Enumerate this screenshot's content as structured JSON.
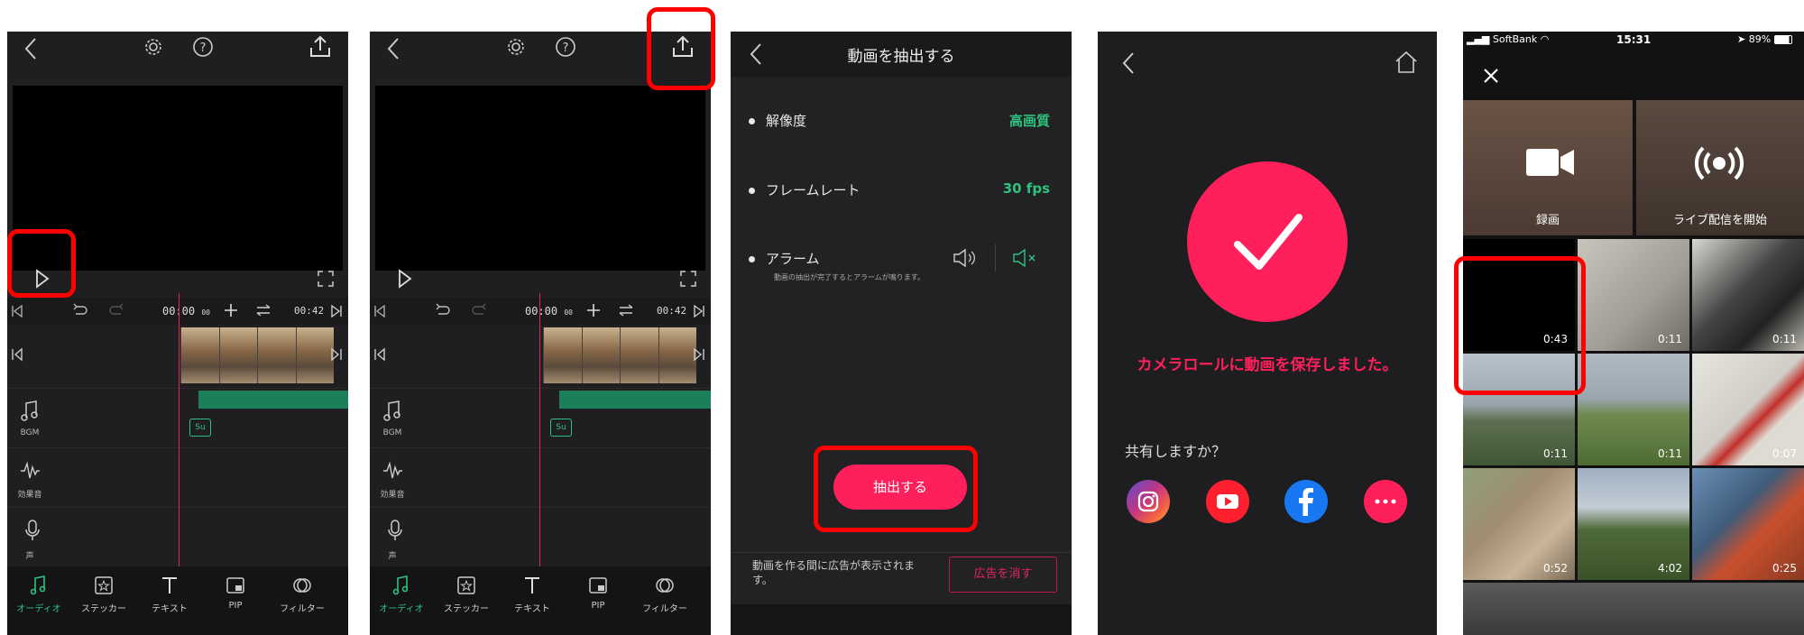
{
  "panel1": {
    "time_readout": "00:00",
    "time_frac": "00",
    "end_time": "00:42",
    "tracks": [
      {
        "label": "BGM"
      },
      {
        "label": "効果音"
      },
      {
        "label": "声"
      }
    ],
    "su_tag": "Su",
    "nav": [
      {
        "label": "オーディオ"
      },
      {
        "label": "ステッカー"
      },
      {
        "label": "テキスト"
      },
      {
        "label": "PIP"
      },
      {
        "label": "フィルター"
      }
    ]
  },
  "panel2": {
    "time_readout": "00:00",
    "time_frac": "00",
    "end_time": "00:42",
    "tracks": [
      {
        "label": "BGM"
      },
      {
        "label": "効果音"
      },
      {
        "label": "声"
      }
    ],
    "su_tag": "Su",
    "nav": [
      {
        "label": "オーディオ"
      },
      {
        "label": "ステッカー"
      },
      {
        "label": "テキスト"
      },
      {
        "label": "PIP"
      },
      {
        "label": "フィルター"
      }
    ]
  },
  "panel3": {
    "title": "動画を抽出する",
    "resolution_label": "解像度",
    "resolution_value": "高画質",
    "framerate_label": "フレームレート",
    "framerate_value": "30 fps",
    "alarm_label": "アラーム",
    "alarm_note": "動画の抽出が完了するとアラームが鳴ります。",
    "extract_button": "抽出する",
    "ad_note": "動画を作る間に広告が表示されます。",
    "remove_ad_button": "広告を消す"
  },
  "panel4": {
    "success_message": "カメラロールに動画を保存しました。",
    "share_question": "共有しますか？",
    "share_targets": [
      "instagram",
      "youtube",
      "facebook",
      "more"
    ],
    "accent": "#ff1f5b"
  },
  "panel5": {
    "carrier": "SoftBank",
    "clock": "15:31",
    "battery": "89%",
    "record_label": "録画",
    "live_label": "ライブ配信を開始",
    "durations": [
      "0:43",
      "0:11",
      "0:11",
      "0:11",
      "0:11",
      "0:07",
      "0:52",
      "4:02",
      "0:25"
    ]
  },
  "colors": {
    "accent_pink": "#ff1f5b",
    "accent_green": "#2ec27e",
    "highlight_red": "#ff0000"
  }
}
